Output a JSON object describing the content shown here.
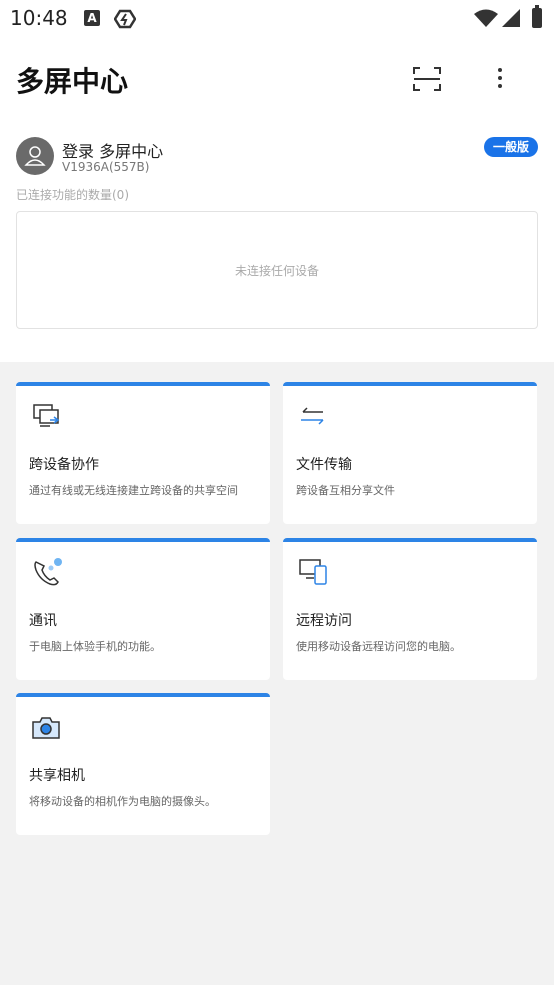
{
  "status_bar": {
    "time": "10:48",
    "a_icon_letter": "A"
  },
  "header": {
    "title": "多屏中心"
  },
  "account": {
    "login_text": "登录 多屏中心",
    "version": "V1936A(557B)",
    "edition_badge": "一般版"
  },
  "connections": {
    "count_label": "已连接功能的数量(0)",
    "empty_text": "未连接任何设备"
  },
  "features": [
    {
      "title": "跨设备协作",
      "description": "通过有线或无线连接建立跨设备的共享空间",
      "icon": "cross-device-icon"
    },
    {
      "title": "文件传输",
      "description": "跨设备互相分享文件",
      "icon": "transfer-icon"
    },
    {
      "title": "通讯",
      "description": "于电脑上体验手机的功能。",
      "icon": "phone-call-icon"
    },
    {
      "title": "远程访问",
      "description": "使用移动设备远程访问您的电脑。",
      "icon": "remote-access-icon"
    },
    {
      "title": "共享相机",
      "description": "将移动设备的相机作为电脑的摄像头。",
      "icon": "camera-icon"
    }
  ],
  "colors": {
    "accent": "#2d84e6",
    "badge": "#1a73e8",
    "background": "#f2f2f2"
  }
}
